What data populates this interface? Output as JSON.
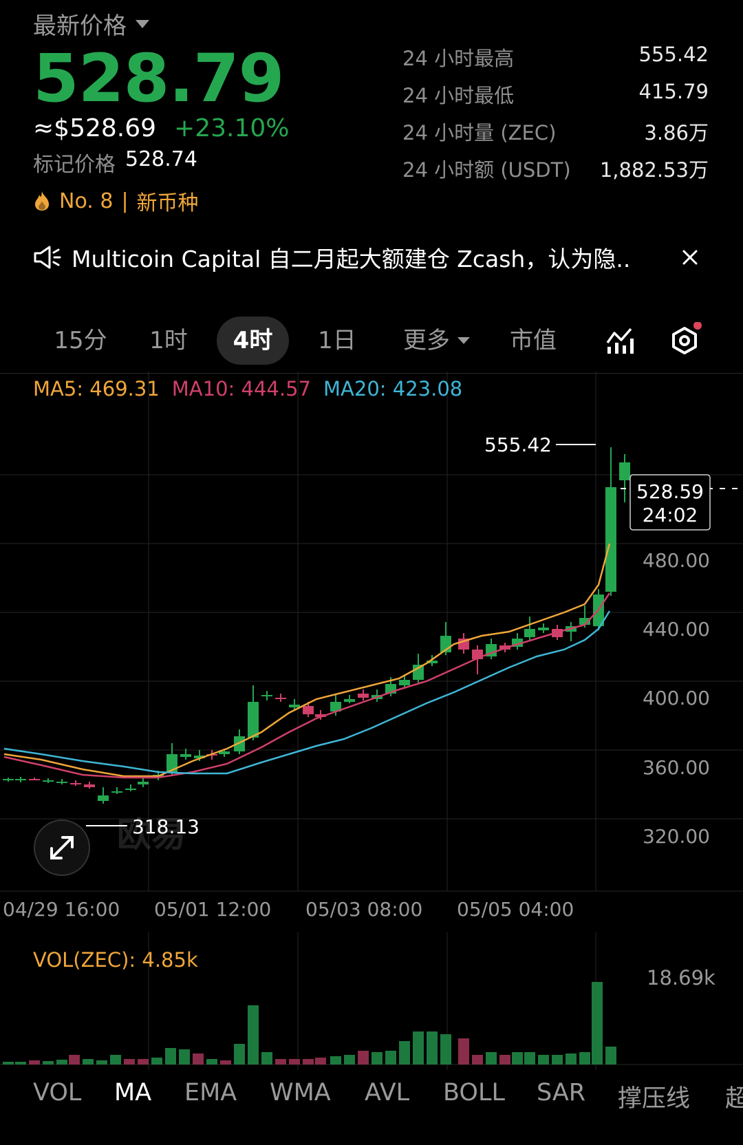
{
  "header": {
    "title": "最新价格"
  },
  "price": {
    "last": "528.79",
    "usd": "≈$528.69",
    "change_pct": "+23.10%",
    "mark_label": "标记价格",
    "mark_value": "528.74",
    "rank": "No. 8",
    "rank_sep": "|",
    "tag": "新币种"
  },
  "stats": [
    {
      "label": "24 小时最高",
      "value": "555.42"
    },
    {
      "label": "24 小时最低",
      "value": "415.79"
    },
    {
      "label": "24 小时量 (ZEC)",
      "value": "3.86万"
    },
    {
      "label": "24 小时额 (USDT)",
      "value": "1,882.53万"
    }
  ],
  "news": {
    "text": "Multicoin Capital 自二月起大额建仓 Zcash，认为隐.."
  },
  "tabs": [
    {
      "label": "15分",
      "active": false
    },
    {
      "label": "1时",
      "active": false
    },
    {
      "label": "4时",
      "active": true
    },
    {
      "label": "1日",
      "active": false
    },
    {
      "label": "更多",
      "active": false
    },
    {
      "label": "市值",
      "active": false
    }
  ],
  "ma_legend": {
    "ma5": "MA5: 469.31",
    "ma10": "MA10: 444.57",
    "ma20": "MA20: 423.08"
  },
  "chart": {
    "high_label": "555.42",
    "low_label": "318.13",
    "current_price": "528.59",
    "countdown": "24:02",
    "y_ticks": [
      "480.00",
      "440.00",
      "400.00",
      "360.00",
      "320.00"
    ],
    "x_ticks": [
      "04/29 16:00",
      "05/01 12:00",
      "05/03 08:00",
      "05/05 04:00"
    ],
    "watermark": "欧易"
  },
  "volume": {
    "label": "VOL(ZEC): 4.85k",
    "max_label": "18.69k"
  },
  "bottom_tabs": [
    "VOL",
    "MA",
    "EMA",
    "WMA",
    "AVL",
    "BOLL",
    "SAR",
    "撑压线",
    "超"
  ],
  "bottom_tab_active": "MA",
  "colors": {
    "up": "#25a750",
    "down": "#d0406a",
    "ma5": "#f0a63a",
    "ma10": "#d0406a",
    "ma20": "#3fb6d6"
  }
}
